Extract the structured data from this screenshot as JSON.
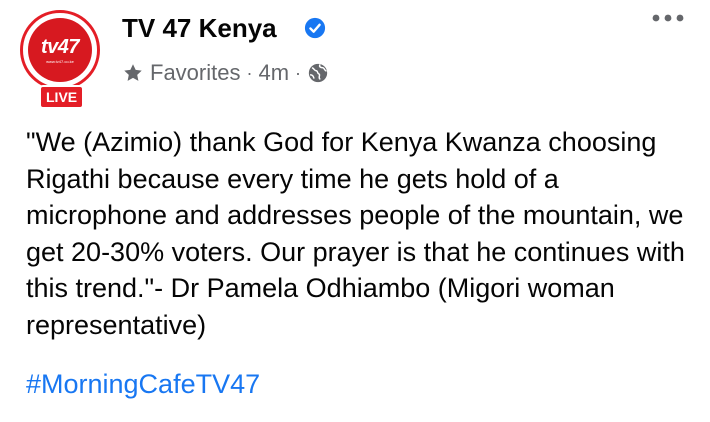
{
  "post": {
    "avatar": {
      "logo_text": "tv47",
      "logo_url": "www.tv47.co.ke",
      "live_label": "LIVE"
    },
    "page_name": "TV 47 Kenya",
    "verified": true,
    "meta": {
      "audience": "Favorites",
      "time": "4m",
      "separator": "·"
    },
    "body": "\"We (Azimio) thank God for Kenya Kwanza choosing Rigathi because every time he gets hold of a microphone and addresses people of the mountain, we get 20-30% voters. Our prayer is that he continues with this trend.\"- Dr Pamela Odhiambo (Migori woman representative)",
    "hashtag": "#MorningCafeTV47"
  },
  "icons": {
    "verified": "verified-badge-icon",
    "audience": "star-icon",
    "privacy": "globe-icon",
    "more": "more-options-icon"
  },
  "colors": {
    "brand_red": "#e41e26",
    "link_blue": "#1877f2",
    "meta_gray": "#65676b",
    "text": "#050505"
  }
}
